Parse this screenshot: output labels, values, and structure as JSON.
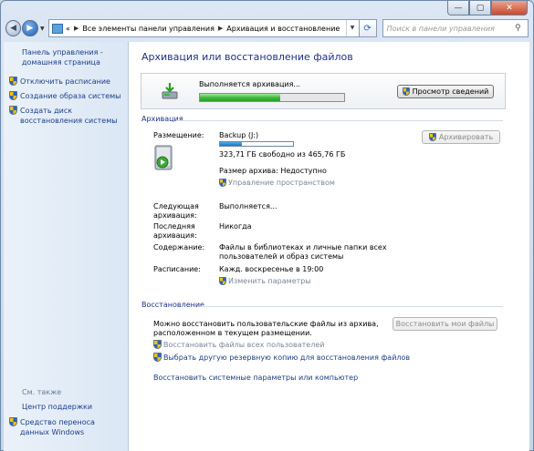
{
  "window": {
    "buttons": {
      "minimize": "—",
      "maximize": "▢",
      "close": "✕"
    }
  },
  "address": {
    "prefix": "«",
    "crumbs": [
      "Все элементы панели управления",
      "Архивация и восстановление"
    ]
  },
  "search": {
    "placeholder": "Поиск в панели управления"
  },
  "sidebar": {
    "home": "Панель управления - домашняя страница",
    "items": [
      {
        "label": "Отключить расписание",
        "icon": "shield-icon"
      },
      {
        "label": "Создание образа системы",
        "icon": "shield-icon"
      },
      {
        "label": "Создать диск восстановления системы",
        "icon": "shield-icon"
      }
    ],
    "see_also": "См. также",
    "see_links": [
      {
        "label": "Центр поддержки"
      },
      {
        "label": "Средство переноса данных Windows",
        "icon": "shield-icon"
      }
    ]
  },
  "main": {
    "title": "Архивация или восстановление файлов",
    "progress": {
      "text": "Выполняется архивация...",
      "fraction": 0.56,
      "button": "Просмотр сведений"
    },
    "backup": {
      "heading": "Архивация",
      "location_label": "Размещение:",
      "location_value": "Backup (J:)",
      "space_used_fraction": 0.3,
      "free_text": "323,71 ГБ свободно из 465,76 ГБ",
      "archive_size": "Размер архива: Недоступно",
      "manage_space": "Управление пространством",
      "archive_button": "Архивировать",
      "next_label": "Следующая архивация:",
      "next_value": "Выполняется...",
      "last_label": "Последняя архивация:",
      "last_value": "Никогда",
      "contents_label": "Содержание:",
      "contents_value": "Файлы в библиотеках и личные папки всех пользователей и образ системы",
      "schedule_label": "Расписание:",
      "schedule_value": "Кажд. воскресенье в 19:00",
      "change_settings": "Изменить параметры"
    },
    "restore": {
      "heading": "Восстановление",
      "text": "Можно восстановить пользовательские файлы из архива, расположенном в текущем размещении.",
      "restore_button": "Восстановить мои файлы",
      "all_users_link": "Восстановить файлы всех пользователей",
      "other_backup_link": "Выбрать другую резервную копию для восстановления файлов",
      "system_link": "Восстановить системные параметры или компьютер"
    }
  }
}
